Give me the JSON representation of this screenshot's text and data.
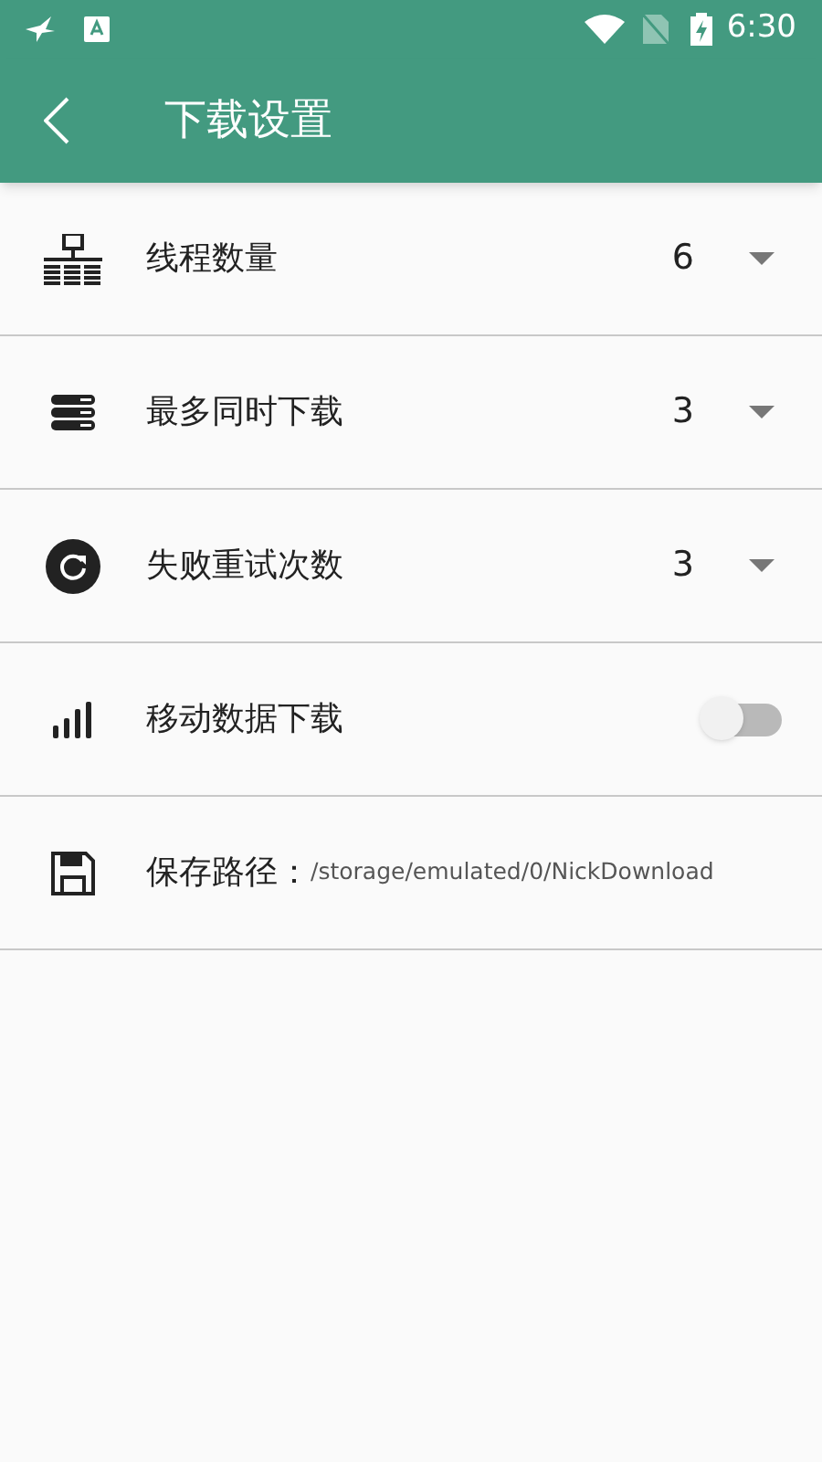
{
  "status_bar": {
    "time": "6:30"
  },
  "app_bar": {
    "title": "下载设置"
  },
  "settings": [
    {
      "kind": "select",
      "label": "线程数量",
      "value": "6"
    },
    {
      "kind": "select",
      "label": "最多同时下载",
      "value": "3"
    },
    {
      "kind": "select",
      "label": "失败重试次数",
      "value": "3"
    },
    {
      "kind": "toggle",
      "label": "移动数据下载",
      "on": false
    },
    {
      "kind": "path",
      "label": "保存路径：",
      "value": "/storage/emulated/0/NickDownload"
    }
  ]
}
